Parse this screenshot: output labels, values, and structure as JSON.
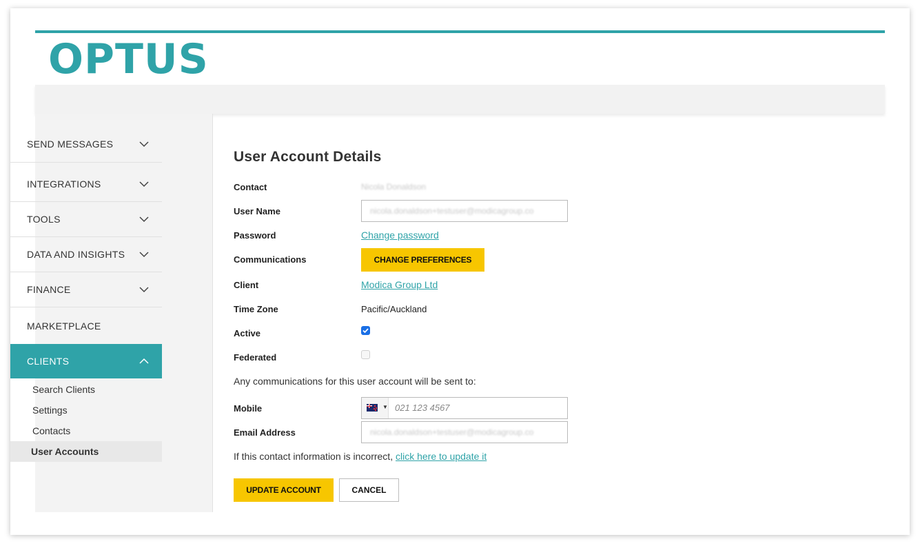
{
  "brand": {
    "logo_text": "OPTUS",
    "accent": "#2fa3a8",
    "button_yellow": "#f7c600"
  },
  "sidebar": {
    "items": [
      {
        "label": "SEND MESSAGES",
        "icon": "chevron-down-icon"
      },
      {
        "label": "INTEGRATIONS",
        "icon": "chevron-down-icon"
      },
      {
        "label": "TOOLS",
        "icon": "chevron-down-icon"
      },
      {
        "label": "DATA AND INSIGHTS",
        "icon": "chevron-down-icon"
      },
      {
        "label": "FINANCE",
        "icon": "chevron-down-icon"
      },
      {
        "label": "MARKETPLACE"
      },
      {
        "label": "CLIENTS",
        "icon": "chevron-up-icon",
        "active": true
      }
    ],
    "sub_items": [
      {
        "label": "Search Clients"
      },
      {
        "label": "Settings"
      },
      {
        "label": "Contacts"
      },
      {
        "label": "User Accounts",
        "selected": true
      }
    ]
  },
  "main": {
    "title": "User Account Details",
    "fields": {
      "contact": {
        "label": "Contact",
        "value": "Nicola Donaldson"
      },
      "username": {
        "label": "User Name",
        "value": "nicola.donaldson+testuser@modicagroup.co"
      },
      "password": {
        "label": "Password",
        "link": "Change password"
      },
      "communications": {
        "label": "Communications",
        "button": "CHANGE PREFERENCES"
      },
      "client": {
        "label": "Client",
        "link": "Modica Group Ltd"
      },
      "timezone": {
        "label": "Time Zone",
        "value": "Pacific/Auckland"
      },
      "active": {
        "label": "Active",
        "checked": true
      },
      "federated": {
        "label": "Federated",
        "checked": false
      }
    },
    "comms_note": "Any communications for this user account will be sent to:",
    "mobile": {
      "label": "Mobile",
      "placeholder": "021 123 4567",
      "flag": "nz-flag-icon"
    },
    "email": {
      "label": "Email Address",
      "value": "nicola.donaldson+testuser@modicagroup.co"
    },
    "incorrect_note": "If this contact information is incorrect,",
    "update_link": "click here to update it",
    "buttons": {
      "update": "UPDATE ACCOUNT",
      "cancel": "CANCEL"
    }
  }
}
